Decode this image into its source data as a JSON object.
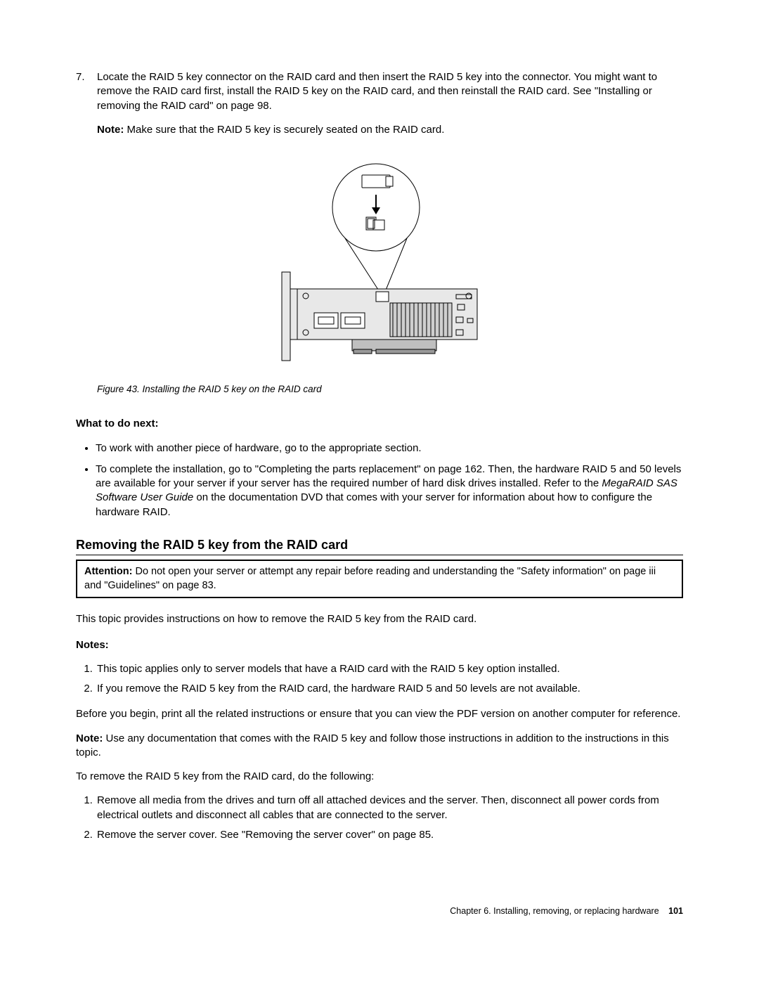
{
  "step7": {
    "num": "7.",
    "body": "Locate the RAID 5 key connector on the RAID card and then insert the RAID 5 key into the connector. You might want to remove the RAID card first, install the RAID 5 key on the RAID card, and then reinstall the RAID card. See \"Installing or removing the RAID card\" on page 98.",
    "noteLabel": "Note:",
    "noteBody": "Make sure that the RAID 5 key is securely seated on the RAID card."
  },
  "figure": {
    "caption": "Figure 43. Installing the RAID 5 key on the RAID card"
  },
  "nextHead": "What to do next:",
  "nextBullets": [
    "To work with another piece of hardware, go to the appropriate section.",
    "To complete the installation, go to \"Completing the parts replacement\" on page 162. Then, the hardware RAID 5 and 50 levels are available for your server if your server has the required number of hard disk drives installed. Refer to the MegaRAID SAS Software User Guide on the documentation DVD that comes with your server for information about how to configure the hardware RAID."
  ],
  "sectionTitle": "Removing the RAID 5 key from the RAID card",
  "attention": {
    "label": "Attention:",
    "body": "Do not open your server or attempt any repair before reading and understanding the \"Safety information\" on page iii and \"Guidelines\" on page 83."
  },
  "intro": "This topic provides instructions on how to remove the RAID 5 key from the RAID card.",
  "notesLabel": "Notes:",
  "notes": [
    "This topic applies only to server models that have a RAID card with the RAID 5 key option installed.",
    "If you remove the RAID 5 key from the RAID card, the hardware RAID 5 and 50 levels are not available."
  ],
  "before": "Before you begin, print all the related instructions or ensure that you can view the PDF version on another computer for reference.",
  "note2Label": "Note:",
  "note2": "Use any documentation that comes with the RAID 5 key and follow those instructions in addition to the instructions in this topic.",
  "todo": "To remove the RAID 5 key from the RAID card, do the following:",
  "steps": [
    "Remove all media from the drives and turn off all attached devices and the server. Then, disconnect all power cords from electrical outlets and disconnect all cables that are connected to the server.",
    "Remove the server cover. See \"Removing the server cover\" on page 85."
  ],
  "footer": {
    "chapter": "Chapter 6. Installing, removing, or replacing hardware",
    "page": "101"
  }
}
